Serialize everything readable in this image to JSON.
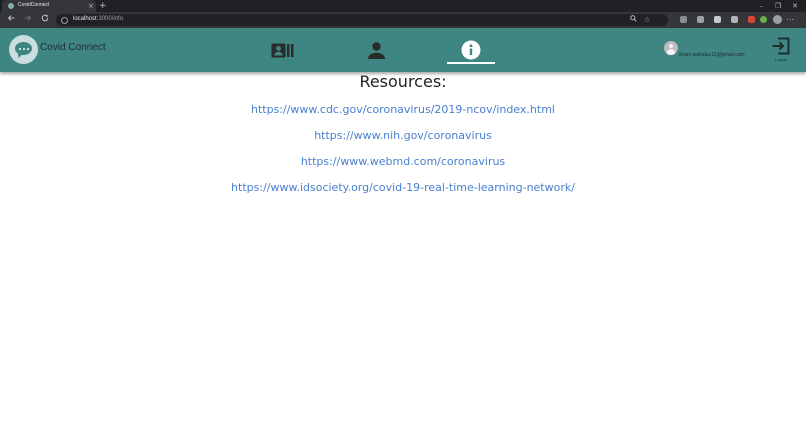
{
  "browser": {
    "tab_title": "CovidConnect",
    "tab_close": "×",
    "new_tab": "+",
    "url_host": "localhost",
    "url_path": ":3000/info",
    "window_minimize": "–",
    "window_restore": "❐",
    "window_close": "✕",
    "menu": "⋯",
    "nav_icons": [
      "arrow-left-icon",
      "arrow-right-icon",
      "reload-icon"
    ]
  },
  "app": {
    "title": "Covid Connect",
    "nav": [
      {
        "icon": "contacts-icon",
        "active": false
      },
      {
        "icon": "person-icon",
        "active": false
      },
      {
        "icon": "info-icon",
        "active": true
      }
    ],
    "user_email": "ikram.wahaba.11@gmail.com",
    "logout_label": "Logout",
    "colors": {
      "header": "#3f8582",
      "link": "#4a7fd1",
      "logo_bg": "#c9dedd"
    }
  },
  "content": {
    "heading": "Resources:",
    "links": [
      "https://www.cdc.gov/coronavirus/2019-ncov/index.html",
      "https://www.nih.gov/coronavirus",
      "https://www.webmd.com/coronavirus",
      "https://www.idsociety.org/covid-19-real-time-learning-network/"
    ]
  }
}
